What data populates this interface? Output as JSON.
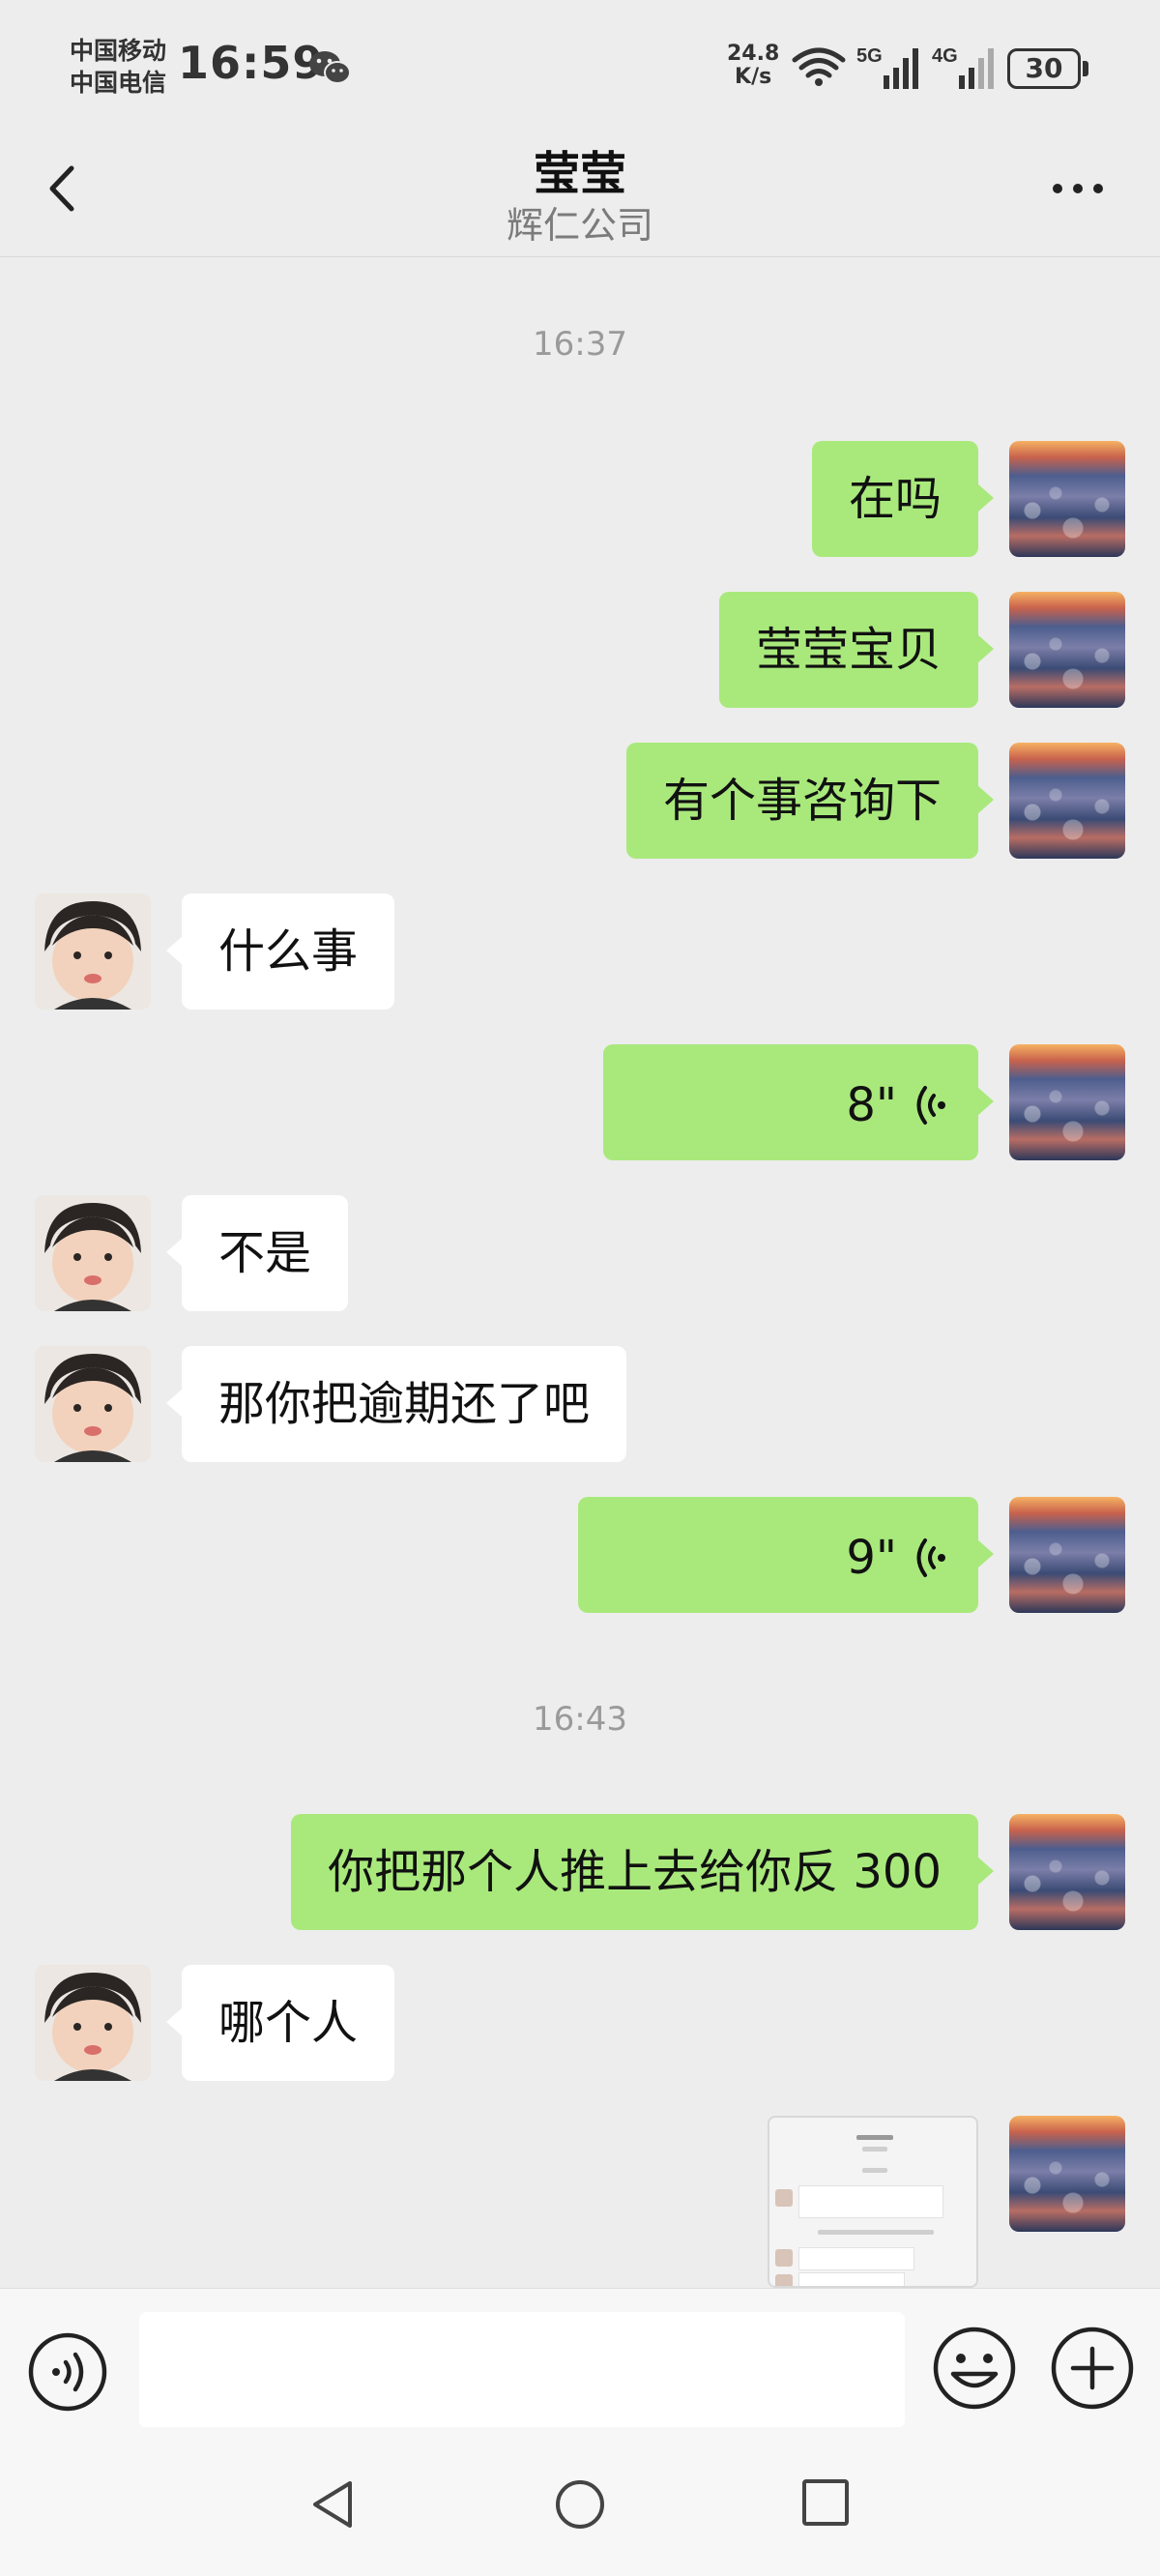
{
  "status_bar": {
    "carrier_1": "中国移动",
    "carrier_2": "中国电信",
    "time": "16:59",
    "net_speed_value": "24.8",
    "net_speed_unit": "K/s",
    "sim1_label": "5G",
    "sim2_label": "4G",
    "battery": "30"
  },
  "header": {
    "title": "莹莹",
    "subtitle": "辉仁公司"
  },
  "messages": {
    "time_1": "16:37",
    "m1": "在吗",
    "m2": "莹莹宝贝",
    "m3": "有个事咨询下",
    "m4": "什么事",
    "m5_voice_duration": "8\"",
    "m6": "不是",
    "m7": "那你把逾期还了吧",
    "m8_voice_duration": "9\"",
    "time_2": "16:43",
    "m9": "你把那个人推上去给你反 300",
    "m10": "哪个人"
  },
  "icons": {
    "back": "chevron-left-icon",
    "more": "more-dots-icon",
    "voice_input": "voice-input-icon",
    "emoji": "emoji-icon",
    "plus": "plus-icon",
    "voice_wave": "voice-wave-icon"
  },
  "colors": {
    "background": "#ededed",
    "my_bubble": "#a9e97c",
    "other_bubble": "#ffffff",
    "timestamp": "#9a9a9a"
  }
}
